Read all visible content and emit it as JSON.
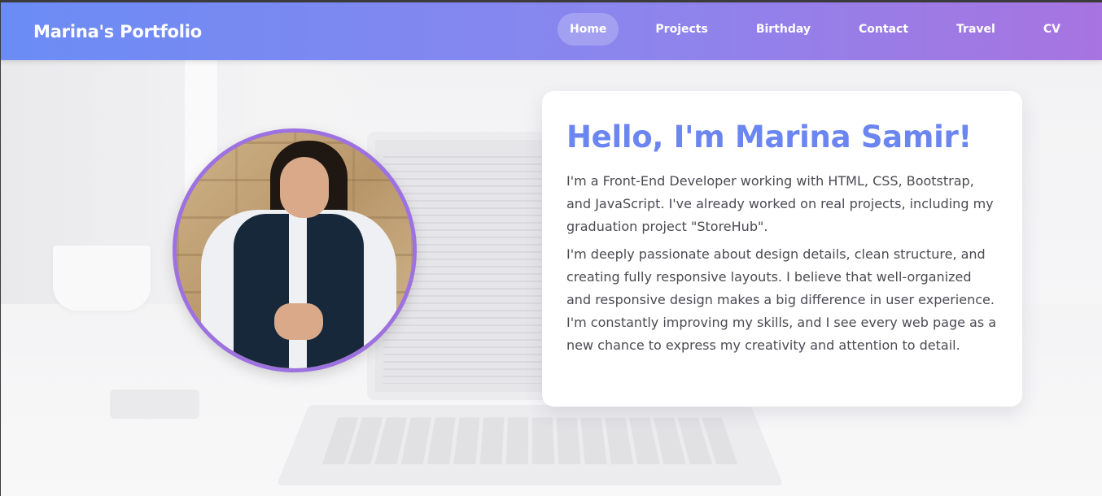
{
  "navbar": {
    "brand": "Marina's Portfolio",
    "links": [
      {
        "label": "Home",
        "active": true
      },
      {
        "label": "Projects",
        "active": false
      },
      {
        "label": "Birthday",
        "active": false
      },
      {
        "label": "Contact",
        "active": false
      },
      {
        "label": "Travel",
        "active": false
      },
      {
        "label": "CV",
        "active": false
      }
    ]
  },
  "hero": {
    "heading": "Hello, I'm Marina Samir!",
    "paragraphs": [
      "I'm a Front-End Developer working with HTML, CSS, Bootstrap, and JavaScript. I've already worked on real projects, including my graduation project \"StoreHub\".",
      "I'm deeply passionate about design details, clean structure, and creating fully responsive layouts. I believe that well-organized and responsive design makes a big difference in user experience. I'm constantly improving my skills, and I see every web page as a new chance to express my creativity and attention to detail."
    ]
  },
  "colors": {
    "nav_gradient_start": "#6b8cf5",
    "nav_gradient_end": "#a774e0",
    "heading": "#6b86f0",
    "avatar_border": "#9d72e0"
  }
}
